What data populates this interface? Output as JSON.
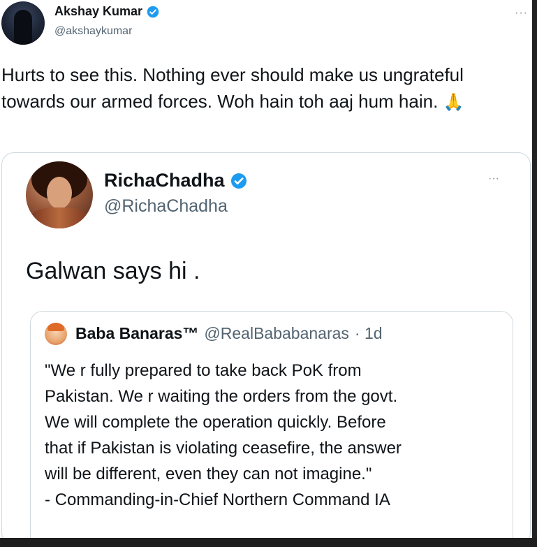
{
  "tweet": {
    "author_name": "Akshay Kumar",
    "author_handle": "@akshaykumar",
    "more": "···",
    "text": "Hurts to see this. Nothing ever should make us ungrateful towards our armed forces. Woh hain toh aaj hum hain.",
    "emoji": "🙏"
  },
  "quote": {
    "author_name": "RichaChadha",
    "author_handle": "@RichaChadha",
    "more": "···",
    "text": "Galwan says hi ."
  },
  "nested_quote": {
    "author_name": "Baba Banaras™",
    "author_handle": "@RealBababanaras",
    "time": "· 1d",
    "lines": [
      "\"We r fully prepared to take back PoK from",
      "Pakistan. We r waiting the orders from the govt.",
      "We will complete the operation quickly. Before",
      "that if Pakistan is violating ceasefire, the answer",
      "will be different, even they can not imagine.\"",
      "- Commanding-in-Chief Northern Command IA"
    ]
  },
  "colors": {
    "verified": "#1d9bf0",
    "secondary_text": "#536471",
    "border": "#cfd9de"
  }
}
